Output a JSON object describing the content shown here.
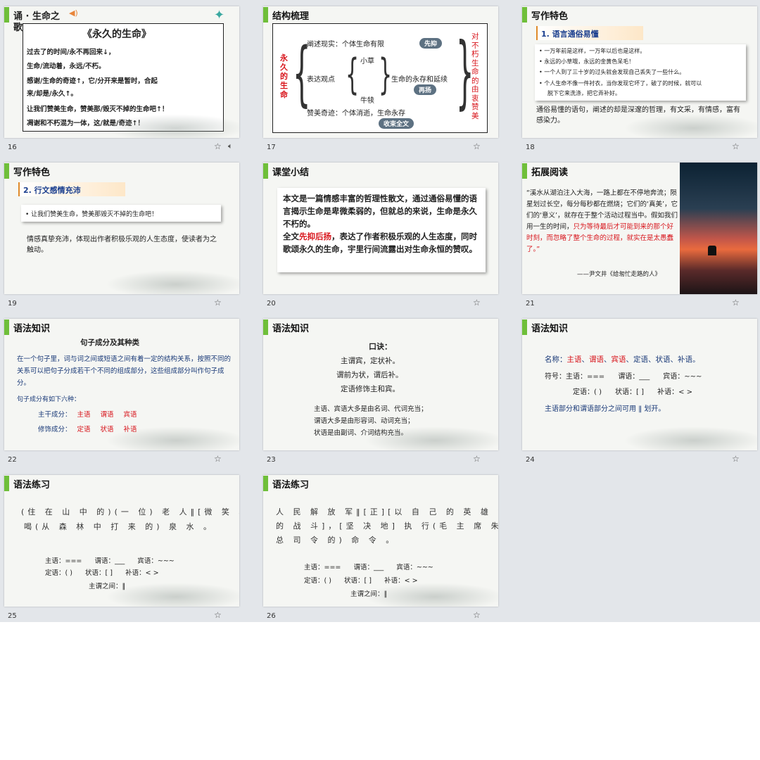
{
  "slides": {
    "s16": {
      "number": "16",
      "title_line1": "诵 · 生命之",
      "title_line2": "歌",
      "poem_title": "《永久的生命》",
      "lines": [
        "过去了的时间/永不再回来↓，",
        "生命/流动着，永远/不朽。",
        "感谢/生命的奇迹↑，它/分开来是暂时，合起",
        "来/却是/永久↑。",
        "让我们赞美生命，赞美那/毁灭不掉的生命吧↑！",
        "凋谢和不朽混为一体，这/就是/奇迹↑！"
      ]
    },
    "s17": {
      "number": "17",
      "title": "结构梳理",
      "root": "永久的生命",
      "b1": "阐述现实：个体生命有限",
      "b1_tag": "先抑",
      "b2": "表达观点",
      "b2a": "小草",
      "b2b": "牛犊",
      "b2c": "生命的永存和延续",
      "b2_tag": "再扬",
      "b3": "赞美奇迹：个体消逝，生命永存",
      "b3_tag": "收束全文",
      "side": "对不朽生命的由衷赞美"
    },
    "s18": {
      "number": "18",
      "title": "写作特色",
      "subtitle": "1. 语言通俗易懂",
      "bullets": [
        "一万年前是这样，一万年以后也是这样。",
        "永远的小草哦，永远的金黄色呆毛！",
        "一个人到了三十岁的过头就会发现自己丢失了一些什么。",
        "个人生命不像一件衬衣，当你发现它坏了，破了的时候，就可以",
        "脱下它来洗涤，把它弄补好。"
      ],
      "summary": "通俗易懂的语句，阐述的却是深邃的哲理，有文采，有情感，富有感染力。"
    },
    "s19": {
      "number": "19",
      "title": "写作特色",
      "subtitle": "2. 行文感情充沛",
      "bullet": "让我们赞美生命，赞美那毁灭不掉的生命吧！",
      "summary": "情感真挚充沛，体现出作者积极乐观的人生态度，使读者为之触动。"
    },
    "s20": {
      "number": "20",
      "title": "课堂小结",
      "p1": "本文是一篇情感丰富的哲理性散文，通过通俗易懂的语言揭示生命是卑微柔弱的，但就总的来说，生命是永久不朽的。",
      "p2_pre": "全文",
      "p2_hl": "先抑后扬",
      "p2_post": "，表达了作者积极乐观的人生态度，同时歌颂永久的生命，宇里行间流露出对生命永恒的赞叹。"
    },
    "s21": {
      "number": "21",
      "title": "拓展阅读",
      "text_black": "“溪水从湖泊注入大海，一路上都在不停地奔流；陨星划过长空，每分每秒都在燃烧；它们的‘真美’，它们的‘意义’，就存在于整个活动过程当中。假如我们用一生的时间，",
      "text_red": "只为等待最后才可能到来的那个好时刻，而忽略了整个生命的过程，就实在是太愚蠢了。”",
      "source": "——尹文井《给匆忙走路的人》"
    },
    "s22": {
      "number": "22",
      "title": "语法知识",
      "heading": "句子成分及其种类",
      "intro": "在一个句子里，词与词之间或短语之间有着一定的结构关系，按照不同的关系可以把句子分成若干个不同的组成部分，这些组成部分叫作句子成分。",
      "six": "句子成分有如下六种：",
      "main_label": "主干成分：",
      "main_items": [
        "主语",
        "谓语",
        "宾语"
      ],
      "mod_label": "修饰成分：",
      "mod_items": [
        "定语",
        "状语",
        "补语"
      ]
    },
    "s23": {
      "number": "23",
      "title": "语法知识",
      "heading": "口诀：",
      "rhyme": [
        "主谓宾，定状补。",
        "谓前为状，谓后补。",
        "定语修饰主和宾。"
      ],
      "notes": [
        "主语、宾语大多是由名词、代词充当；",
        "谓语大多是由形容词、动词充当；",
        "状语是由副词、介词结构充当。"
      ]
    },
    "s24": {
      "number": "24",
      "title": "语法知识",
      "name_label": "名称：",
      "names": [
        "主语",
        "谓语",
        "宾语",
        "定语",
        "状语",
        "补语"
      ],
      "symbol_line1": "符号：主语：===      谓语：___      宾语：~~~",
      "symbol_line2": "定语：( )      状语：[ ]      补语：< >",
      "divide_note": "主语部分和谓语部分之间可用 ‖ 划开。"
    },
    "s25": {
      "number": "25",
      "title": "语法练习",
      "line1": "(住 在 山 中 的)(一 位) 老 人‖[微 笑 着]",
      "line2": "喝(从 森 林 中 打 来 的) 泉 水 。",
      "legend1": "主语：===      谓语：___      宾语：~~~",
      "legend2": "定语：( )      状语：[ ]      补语：< >",
      "legend3": "主谓之间：‖"
    },
    "s26": {
      "number": "26",
      "title": "语法练习",
      "line1": "人 民 解 放 军‖[正][以 自 己 的 英 雄 式",
      "line2": "的 战 斗]，[坚 决 地] 执 行(毛 主 席 朱",
      "line3": "总 司 令 的) 命 令 。",
      "legend1": "主语：===      谓语：___      宾语：~~~",
      "legend2": "定语：( )      状语：[ ]      补语：< >",
      "legend3": "主谓之间：‖"
    }
  },
  "icons": {
    "star": "star-icon",
    "speaker": "speaker-icon"
  },
  "colors": {
    "accent_green": "#6fbf3a",
    "red": "#d8141b",
    "blue": "#1b3f8f",
    "pill": "#5d7182"
  }
}
